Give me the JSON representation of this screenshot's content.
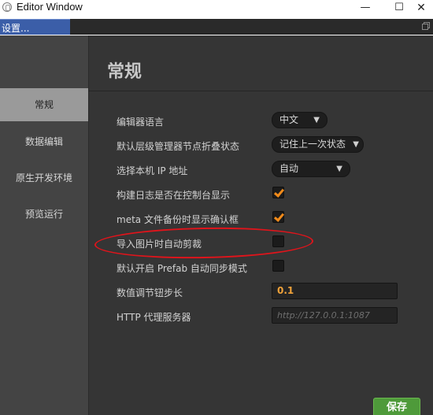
{
  "window": {
    "title": "Editor Window",
    "minimize_glyph": "—",
    "maximize_glyph": "☐",
    "close_glyph": "✕"
  },
  "tab": {
    "label": "设置..."
  },
  "sidebar": {
    "items": [
      {
        "label": "常规",
        "active": true
      },
      {
        "label": "数据编辑",
        "active": false
      },
      {
        "label": "原生开发环境",
        "active": false
      },
      {
        "label": "预览运行",
        "active": false
      }
    ]
  },
  "main": {
    "title": "常规",
    "settings": {
      "editor_language": {
        "label": "编辑器语言",
        "value": "中文",
        "arrow": "▼"
      },
      "hierarchy_fold": {
        "label": "默认层级管理器节点折叠状态",
        "value": "记住上一次状态",
        "arrow": "▼"
      },
      "local_ip": {
        "label": "选择本机 IP 地址",
        "value": "自动",
        "arrow": "▼"
      },
      "build_log": {
        "label": "构建日志是否在控制台显示",
        "checked": true
      },
      "meta_backup": {
        "label": "meta 文件备份时显示确认框",
        "checked": true
      },
      "auto_trim": {
        "label": "导入图片时自动剪裁",
        "checked": false
      },
      "prefab_sync": {
        "label": "默认开启 Prefab 自动同步模式",
        "checked": false
      },
      "step": {
        "label": "数值调节钮步长",
        "value": "0.1"
      },
      "http_proxy": {
        "label": "HTTP 代理服务器",
        "placeholder": "http://127.0.0.1:1087"
      }
    },
    "save_label": "保存"
  },
  "colors": {
    "accent_check": "#f08a1a",
    "save_button": "#4e9a3a",
    "tab_active": "#3b5ea8",
    "annotation": "#e0141b"
  }
}
